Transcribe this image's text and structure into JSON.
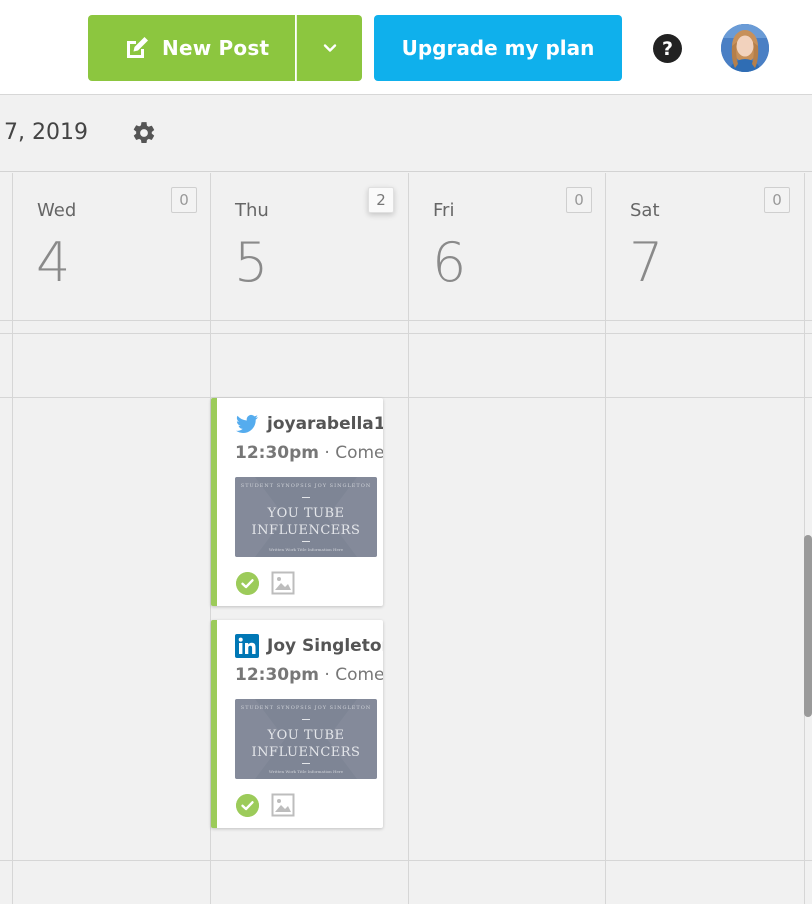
{
  "toolbar": {
    "new_post_label": "New Post",
    "upgrade_label": "Upgrade my plan",
    "help_label": "?"
  },
  "date_header": {
    "date_text": "7, 2019"
  },
  "days": [
    {
      "name": "Wed",
      "number": "4",
      "count": "0"
    },
    {
      "name": "Thu",
      "number": "5",
      "count": "2"
    },
    {
      "name": "Fri",
      "number": "6",
      "count": "0"
    },
    {
      "name": "Sat",
      "number": "7",
      "count": "0"
    }
  ],
  "posts": [
    {
      "network": "twitter",
      "account": "joyarabella1",
      "time": "12:30pm",
      "status": "Come",
      "thumb": {
        "line1": "STUDENT SYNOPSIS  JOY SINGLETON",
        "line2a": "YOU TUBE",
        "line2b": "INFLUENCERS",
        "line3": "Written Work Title Information Here"
      }
    },
    {
      "network": "linkedin",
      "account": "Joy Singleton",
      "time": "12:30pm",
      "status": "Come",
      "thumb": {
        "line1": "STUDENT SYNOPSIS  JOY SINGLETON",
        "line2a": "YOU TUBE",
        "line2b": "INFLUENCERS",
        "line3": "Written Work Title Information Here"
      }
    }
  ],
  "colors": {
    "new_post_green": "#8cc63f",
    "upgrade_blue": "#0fb0ec",
    "post_accent": "#9ccb5a",
    "twitter": "#55acee",
    "linkedin": "#0077b5"
  }
}
